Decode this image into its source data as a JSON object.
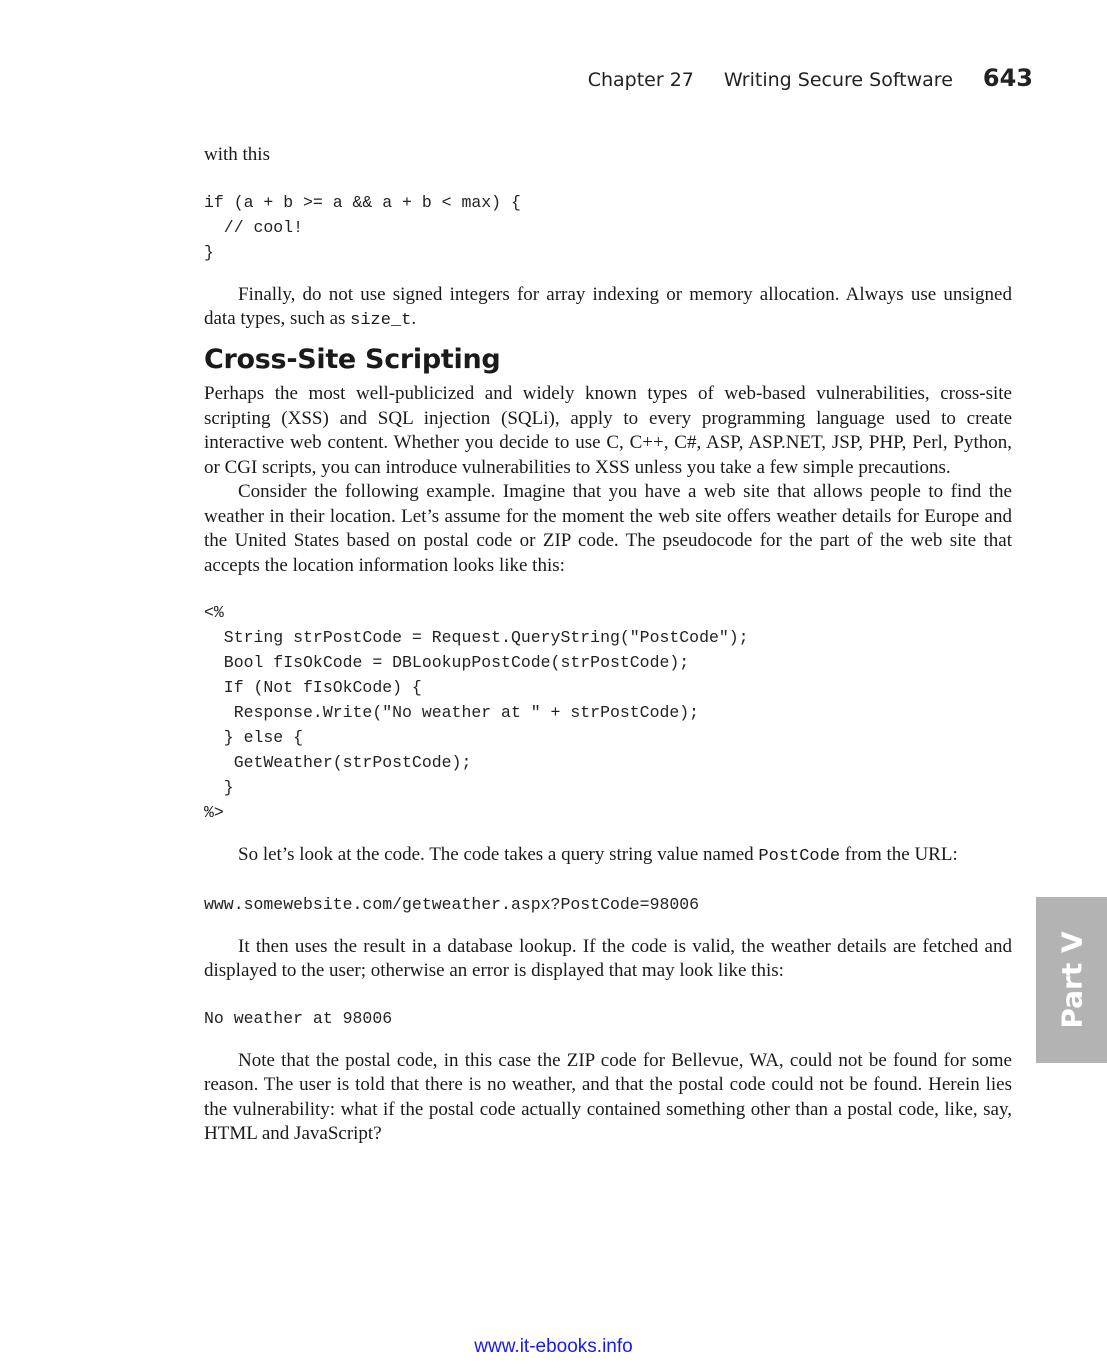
{
  "header": {
    "chapter": "Chapter 27",
    "title": "Writing Secure Software",
    "page_number": "643"
  },
  "intro": "with this",
  "code1": [
    "if (a + b >= a && a + b < max) {",
    "  // cool!",
    "}"
  ],
  "para1": {
    "text": "Finally, do not use signed integers for array indexing or memory allocation. Always use unsigned data types, such as ",
    "code": "size_t",
    "end": "."
  },
  "section_heading": "Cross-Site Scripting",
  "para2": "Perhaps the most well-publicized and widely known types of web-based vulnerabilities, cross-site scripting (XSS) and SQL injection (SQLi), apply to every programming language used to create interactive web content. Whether you decide to use C, C++, C#, ASP, ASP.NET, JSP, PHP, Perl, Python, or CGI scripts, you can introduce vulnerabilities to XSS unless you take a few simple precautions.",
  "para3": "Consider the following example. Imagine that you have a web site that allows people to find the weather in their location. Let’s assume for the moment the web site offers weather details for Europe and the United States based on postal code or ZIP code. The pseudocode for the part of the web site that accepts the location information looks like this:",
  "code2": [
    "<%",
    "  String strPostCode = Request.QueryString(\"PostCode\");",
    "  Bool fIsOkCode = DBLookupPostCode(strPostCode);",
    "  If (Not fIsOkCode) {",
    "   Response.Write(\"No weather at \" + strPostCode);",
    "  } else {",
    "   GetWeather(strPostCode);",
    "  }",
    "%>"
  ],
  "para4": {
    "text": "So let’s look at the code. The code takes a query string value named ",
    "code": "PostCode",
    "end": " from the URL:"
  },
  "code3": "www.somewebsite.com/getweather.aspx?PostCode=98006",
  "para5": "It then uses the result in a database lookup. If the code is valid, the weather details are fetched and displayed to the user; otherwise an error is displayed that may look like this:",
  "code4": "No weather at 98006",
  "para6": "Note that the postal code, in this case the ZIP code for Bellevue, WA, could not be found for some reason. The user is told that there is no weather, and that the postal code could not be found. Herein lies the vulnerability: what if the postal code actually contained something other than a postal code, like, say, HTML and JavaScript?",
  "side_tab": {
    "label": "Part V",
    "color": "#b3b3b3"
  },
  "footer": {
    "link": "www.it-ebooks.info",
    "color": "#1a1ae6"
  }
}
